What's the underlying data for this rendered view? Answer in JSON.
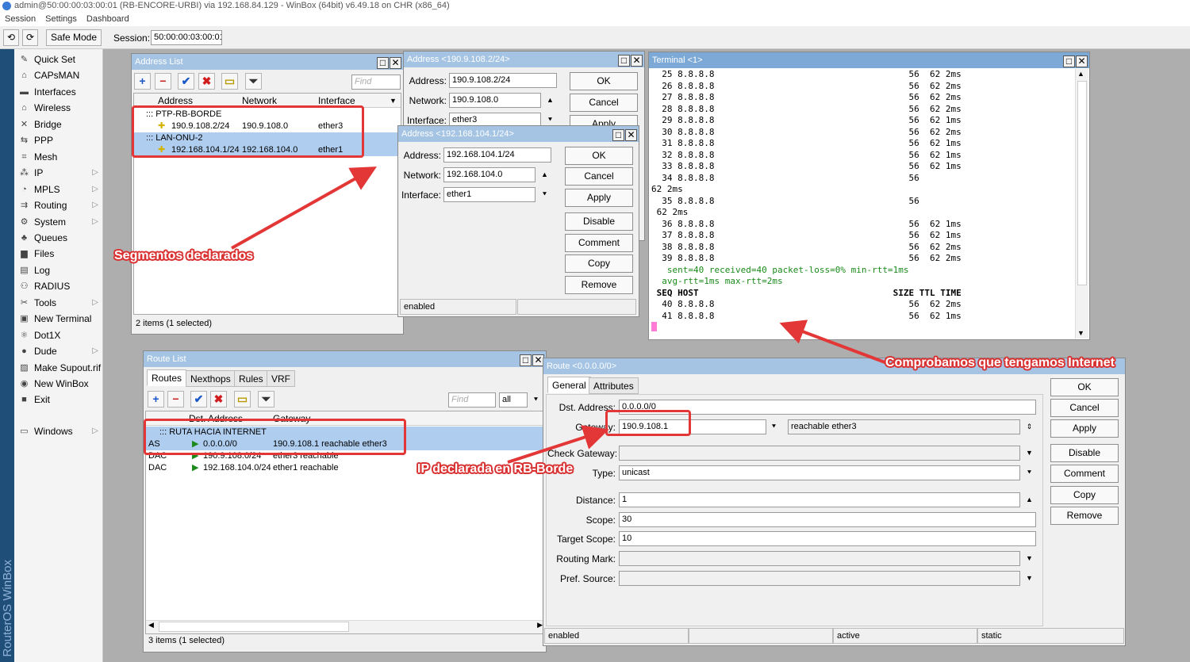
{
  "titlebar": {
    "text": "admin@50:00:00:03:00:01 (RB-ENCORE-URBI) via 192.168.84.129 - WinBox (64bit) v6.49.18 on CHR (x86_64)"
  },
  "menubar": {
    "session": "Session",
    "settings": "Settings",
    "dashboard": "Dashboard"
  },
  "toolbar": {
    "undo": "⟲",
    "redo": "⟳",
    "safe_mode": "Safe Mode",
    "session_label": "Session:",
    "session_value": "50:00:00:03:00:01"
  },
  "side_brand": "RouterOS WinBox",
  "sidemenu": [
    {
      "label": "Quick Set",
      "icon": "✎"
    },
    {
      "label": "CAPsMAN",
      "icon": "⌂"
    },
    {
      "label": "Interfaces",
      "icon": "▬"
    },
    {
      "label": "Wireless",
      "icon": "⌂"
    },
    {
      "label": "Bridge",
      "icon": "✕"
    },
    {
      "label": "PPP",
      "icon": "⇆"
    },
    {
      "label": "Mesh",
      "icon": "⌗"
    },
    {
      "label": "IP",
      "icon": "⁂",
      "arrow": "▷"
    },
    {
      "label": "MPLS",
      "icon": "◔",
      "arrow": "▷"
    },
    {
      "label": "Routing",
      "icon": "⇉",
      "arrow": "▷"
    },
    {
      "label": "System",
      "icon": "⚙",
      "arrow": "▷"
    },
    {
      "label": "Queues",
      "icon": "♣"
    },
    {
      "label": "Files",
      "icon": "▆"
    },
    {
      "label": "Log",
      "icon": "▤"
    },
    {
      "label": "RADIUS",
      "icon": "⚇"
    },
    {
      "label": "Tools",
      "icon": "✂",
      "arrow": "▷"
    },
    {
      "label": "New Terminal",
      "icon": "▣"
    },
    {
      "label": "Dot1X",
      "icon": "⚛"
    },
    {
      "label": "Dude",
      "icon": "●",
      "arrow": "▷"
    },
    {
      "label": "Make Supout.rif",
      "icon": "▨"
    },
    {
      "label": "New WinBox",
      "icon": "◉"
    },
    {
      "label": "Exit",
      "icon": "■"
    }
  ],
  "sidemenu_windows": {
    "label": "Windows",
    "arrow": "▷",
    "icon": "▭"
  },
  "address_list": {
    "title": "Address List",
    "find": "Find",
    "columns": [
      "Address",
      "Network",
      "Interface"
    ],
    "groups": [
      {
        "name": "::: PTP-RB-BORDE",
        "address": "190.9.108.2/24",
        "network": "190.9.108.0",
        "interface": "ether3"
      },
      {
        "name": "::: LAN-ONU-2",
        "address": "192.168.104.1/24",
        "network": "192.168.104.0",
        "interface": "ether1"
      }
    ],
    "status": "2 items (1 selected)"
  },
  "addr_win1": {
    "title": "Address <190.9.108.2/24>",
    "address_label": "Address:",
    "address": "190.9.108.2/24",
    "network_label": "Network:",
    "network": "190.9.108.0",
    "interface_label": "Interface:",
    "interface": "ether3",
    "ok": "OK",
    "cancel": "Cancel",
    "apply": "Apply"
  },
  "addr_win2": {
    "title": "Address <192.168.104.1/24>",
    "address_label": "Address:",
    "address": "192.168.104.1/24",
    "network_label": "Network:",
    "network": "192.168.104.0",
    "interface_label": "Interface:",
    "interface": "ether1",
    "ok": "OK",
    "cancel": "Cancel",
    "apply": "Apply",
    "disable": "Disable",
    "comment": "Comment",
    "copy": "Copy",
    "remove": "Remove",
    "status": "enabled"
  },
  "terminal": {
    "title": "Terminal <1>",
    "text": "  25 8.8.8.8                                     56  62 2ms\n  26 8.8.8.8                                     56  62 2ms\n  27 8.8.8.8                                     56  62 2ms\n  28 8.8.8.8                                     56  62 2ms\n  29 8.8.8.8                                     56  62 1ms\n  30 8.8.8.8                                     56  62 2ms\n  31 8.8.8.8                                     56  62 1ms\n  32 8.8.8.8                                     56  62 1ms\n  33 8.8.8.8                                     56  62 1ms\n  34 8.8.8.8                                     56\n62 2ms\n  35 8.8.8.8                                     56\n 62 2ms\n  36 8.8.8.8                                     56  62 1ms\n  37 8.8.8.8                                     56  62 1ms\n  38 8.8.8.8                                     56  62 2ms\n  39 8.8.8.8                                     56  62 2ms",
    "summary1": "   sent=40 received=40 packet-loss=0% min-rtt=1ms",
    "summary2": "  avg-rtt=1ms max-rtt=2ms",
    "header": " SEQ HOST                                     SIZE TTL TIME",
    "tail": "  40 8.8.8.8                                     56  62 2ms\n  41 8.8.8.8                                     56  62 1ms"
  },
  "route_list": {
    "title": "Route List",
    "tabs": [
      "Routes",
      "Nexthops",
      "Rules",
      "VRF"
    ],
    "find": "Find",
    "filter": "all",
    "columns": [
      "Dst. Address",
      "Gateway"
    ],
    "group": "::: RUTA HACIA INTERNET",
    "rows": [
      {
        "flags": "AS",
        "dst": "0.0.0.0/0",
        "gw": "190.9.108.1 reachable ether3"
      },
      {
        "flags": "DAC",
        "dst": "190.9.108.0/24",
        "gw": "ether3 reachable"
      },
      {
        "flags": "DAC",
        "dst": "192.168.104.0/24",
        "gw": "ether1 reachable"
      }
    ],
    "status": "3 items (1 selected)"
  },
  "route_win": {
    "title": "Route <0.0.0.0/0>",
    "tabs": [
      "General",
      "Attributes"
    ],
    "dst_label": "Dst. Address:",
    "dst": "0.0.0.0/0",
    "gw_label": "Gateway:",
    "gw": "190.9.108.1",
    "gw_state": "reachable ether3",
    "check_gw_label": "Check Gateway:",
    "type_label": "Type:",
    "type": "unicast",
    "distance_label": "Distance:",
    "distance": "1",
    "scope_label": "Scope:",
    "scope": "30",
    "target_scope_label": "Target Scope:",
    "target_scope": "10",
    "routing_mark_label": "Routing Mark:",
    "pref_source_label": "Pref. Source:",
    "ok": "OK",
    "cancel": "Cancel",
    "apply": "Apply",
    "disable": "Disable",
    "comment": "Comment",
    "copy": "Copy",
    "remove": "Remove",
    "status": [
      "enabled",
      "",
      "active",
      "static"
    ]
  },
  "annotations": {
    "segmentos": "Segmentos declarados",
    "internet": "Comprobamos que tengamos Internet",
    "ip_declarada": "IP declarada en RB-Borde"
  },
  "colors": {
    "annotation_red": "#e33636",
    "title_blue": "#7da9d6",
    "selection": "#aecdef"
  }
}
